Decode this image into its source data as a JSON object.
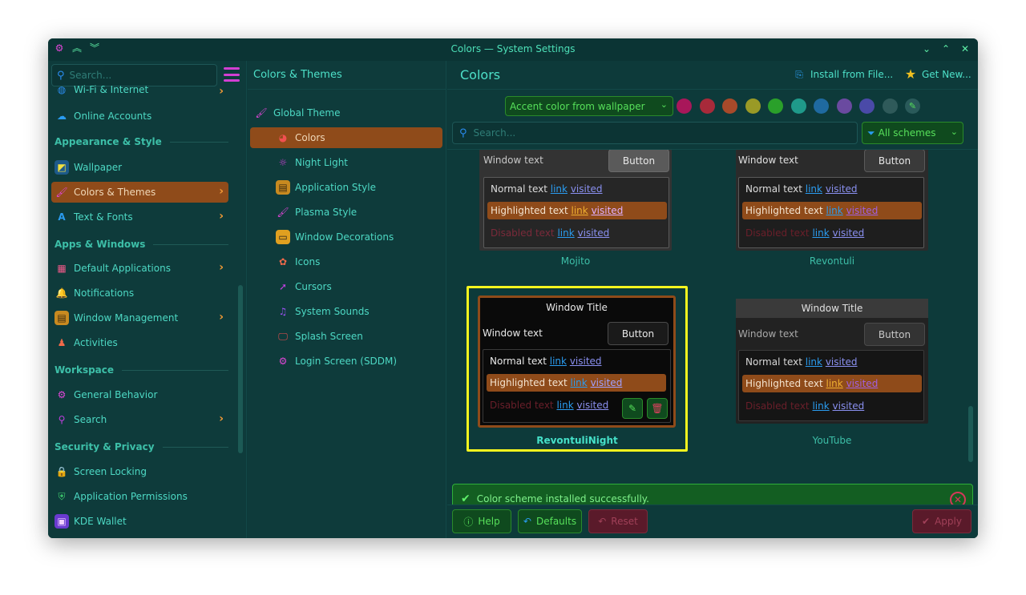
{
  "window": {
    "title": "Colors — System Settings"
  },
  "sidebar": {
    "search_placeholder": "Search...",
    "sections": {
      "appearance": "Appearance & Style",
      "apps": "Apps & Windows",
      "workspace": "Workspace",
      "security": "Security & Privacy"
    },
    "items": {
      "wifi": "Wi-Fi & Internet",
      "online_accounts": "Online Accounts",
      "wallpaper": "Wallpaper",
      "colors_themes": "Colors & Themes",
      "text_fonts": "Text & Fonts",
      "default_apps": "Default Applications",
      "notifications": "Notifications",
      "window_mgmt": "Window Management",
      "activities": "Activities",
      "general_behavior": "General Behavior",
      "search": "Search",
      "screen_locking": "Screen Locking",
      "app_permissions": "Application Permissions",
      "kde_wallet": "KDE Wallet"
    }
  },
  "middle": {
    "header": "Colors & Themes",
    "items": {
      "global_theme": "Global Theme",
      "colors": "Colors",
      "night_light": "Night Light",
      "app_style": "Application Style",
      "plasma_style": "Plasma Style",
      "window_decorations": "Window Decorations",
      "icons": "Icons",
      "cursors": "Cursors",
      "system_sounds": "System Sounds",
      "splash_screen": "Splash Screen",
      "login_screen": "Login Screen (SDDM)"
    }
  },
  "main": {
    "title": "Colors",
    "install_label": "Install from File...",
    "get_new_label": "Get New...",
    "accent_select": "Accent color from wallpaper",
    "accent_colors": [
      "#a8175a",
      "#a82a3a",
      "#a84a2a",
      "#9a9a26",
      "#2aa02a",
      "#1f9a8a",
      "#1f6aa0",
      "#6a4aa0",
      "#4a4aa8",
      "#2f5a5a"
    ],
    "search_placeholder": "Search...",
    "filter_label": "All schemes",
    "preview": {
      "window_title": "Window Title",
      "window_text": "Window text",
      "button": "Button",
      "normal_text": "Normal text",
      "highlighted_text": "Highlighted text",
      "disabled_text": "Disabled text",
      "link": "link",
      "visited": "visited"
    },
    "schemes": [
      "Mojito",
      "Revontuli",
      "RevontuliNight",
      "YouTube"
    ],
    "notice": "Color scheme installed successfully."
  },
  "footer": {
    "help": "Help",
    "defaults": "Defaults",
    "reset": "Reset",
    "apply": "Apply"
  }
}
